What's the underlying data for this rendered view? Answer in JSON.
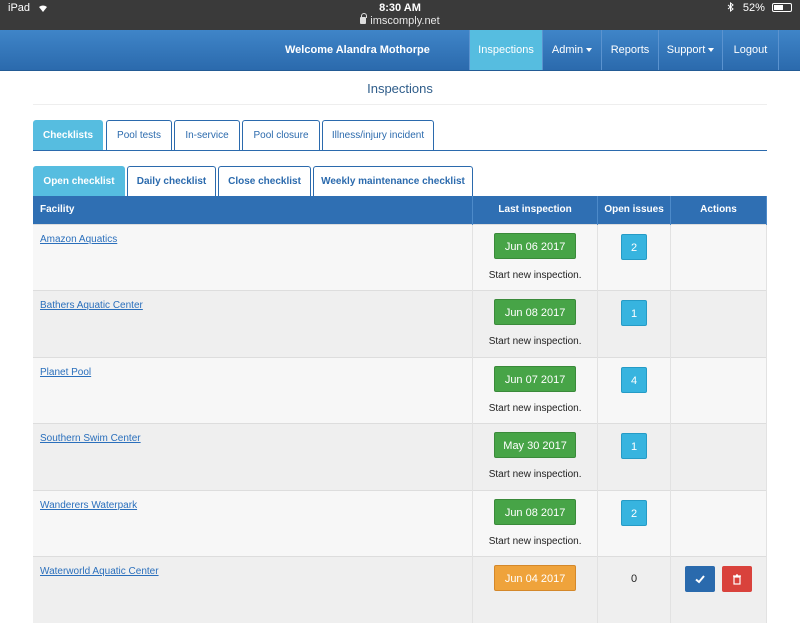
{
  "status_bar": {
    "device": "iPad",
    "time": "8:30 AM",
    "url": "imscomply.net",
    "battery": "52%"
  },
  "header": {
    "welcome": "Welcome Alandra Mothorpe",
    "nav": [
      {
        "label": "Inspections",
        "active": true
      },
      {
        "label": "Admin",
        "dropdown": true
      },
      {
        "label": "Reports"
      },
      {
        "label": "Support",
        "dropdown": true
      },
      {
        "label": "Logout"
      }
    ]
  },
  "page": {
    "title": "Inspections"
  },
  "primary_tabs": [
    "Checklists",
    "Pool tests",
    "In-service",
    "Pool closure",
    "Illness/injury incident"
  ],
  "secondary_tabs": [
    "Open checklist",
    "Daily checklist",
    "Close checklist",
    "Weekly maintenance checklist"
  ],
  "table": {
    "columns": [
      "Facility",
      "Last inspection",
      "Open issues",
      "Actions"
    ],
    "rows": [
      {
        "facility": "Amazon Aquatics",
        "last_inspection": "Jun 06 2017",
        "note": "Start new inspection.",
        "open_issues": "2"
      },
      {
        "facility": "Bathers Aquatic Center",
        "last_inspection": "Jun 08 2017",
        "note": "Start new inspection.",
        "open_issues": "1"
      },
      {
        "facility": "Planet Pool",
        "last_inspection": "Jun 07 2017",
        "note": "Start new inspection.",
        "open_issues": "4"
      },
      {
        "facility": "Southern Swim Center",
        "last_inspection": "May 30 2017",
        "note": "Start new inspection.",
        "open_issues": "1"
      },
      {
        "facility": "Wanderers Waterpark",
        "last_inspection": "Jun 08 2017",
        "note": "Start new inspection.",
        "open_issues": "2"
      },
      {
        "facility": "Waterworld Aquatic Center",
        "last_inspection": "Jun 04 2017",
        "open_issues": "0"
      }
    ]
  },
  "icons": {
    "complete": "checkmark-icon",
    "delete": "trash-icon"
  },
  "colors": {
    "brand": "#2f6fb3",
    "active": "#56bde0",
    "success": "#47a447",
    "warning": "#efa33b",
    "danger": "#d9423c"
  }
}
